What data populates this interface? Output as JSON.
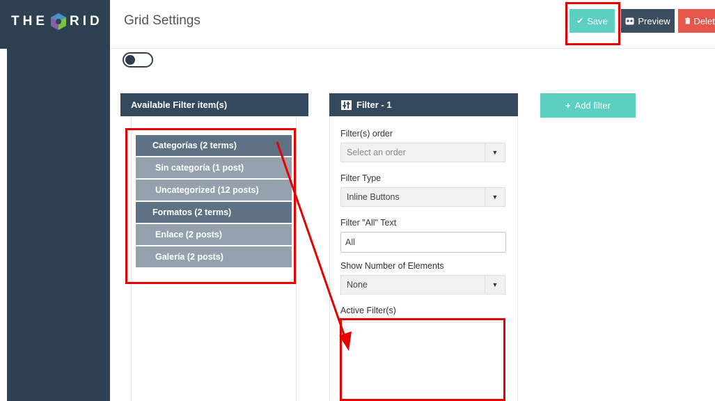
{
  "brand": {
    "text_left": "THE",
    "text_right": "RID",
    "logo_icon": "grid-logo-icon"
  },
  "header": {
    "title": "Grid Settings",
    "save_label": "Save",
    "preview_label": "Preview",
    "delete_label": "Delete",
    "save_icon": "check-icon",
    "preview_icon": "eye-icon",
    "delete_icon": "trash-icon"
  },
  "available_panel": {
    "title": "Available Filter item(s)",
    "groups": [
      {
        "label": "Categorías (2 terms)",
        "terms": [
          "Sin categoría (1 post)",
          "Uncategorized (12 posts)"
        ]
      },
      {
        "label": "Formatos (2 terms)",
        "terms": [
          "Enlace (2 posts)",
          "Galería (2 posts)"
        ]
      }
    ]
  },
  "filter_panel": {
    "title": "Filter - 1",
    "icon": "filter-sliders-icon",
    "order_label": "Filter(s) order",
    "order_placeholder": "Select an order",
    "type_label": "Filter Type",
    "type_value": "Inline Buttons",
    "all_text_label": "Filter \"All\" Text",
    "all_text_value": "All",
    "show_number_label": "Show Number of Elements",
    "show_number_value": "None",
    "active_label": "Active Filter(s)"
  },
  "add_filter_label": "Add filter",
  "colors": {
    "accent": "#5ccfc2",
    "sidebar": "#2f4255",
    "panel_header": "#34495e",
    "category_item": "#5e7185",
    "term_item": "#95a1ac",
    "delete": "#e8574d",
    "annotation": "#e60000"
  }
}
